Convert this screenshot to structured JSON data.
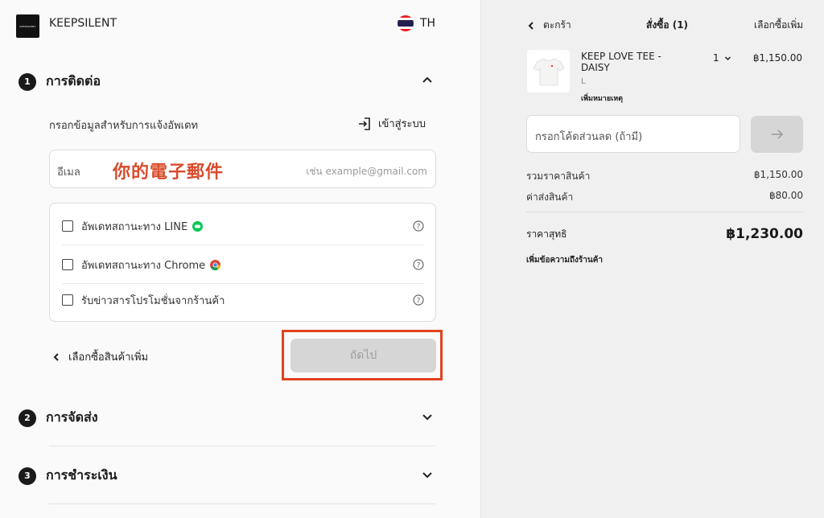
{
  "header": {
    "logo_text": "KEEPSILENT",
    "brand": "KEEPSILENT",
    "language": "TH"
  },
  "steps": [
    {
      "number": "1",
      "title": "การติดต่อ",
      "expanded": true
    },
    {
      "number": "2",
      "title": "การจัดส่ง",
      "expanded": false
    },
    {
      "number": "3",
      "title": "การชำระเงิน",
      "expanded": false
    }
  ],
  "contact": {
    "instruction": "กรอกข้อมูลสำหรับการแจ้งอัพเดท",
    "login_label": "เข้าสู่ระบบ",
    "email_label": "อีเมล",
    "email_value": "你的電子郵件",
    "email_placeholder": "เช่น example@gmail.com",
    "options": [
      {
        "label": "อัพเดทสถานะทาง LINE",
        "icon": "line-icon",
        "checked": false
      },
      {
        "label": "อัพเดทสถานะทาง Chrome",
        "icon": "chrome-icon",
        "checked": false
      },
      {
        "label": "รับข่าวสารโปรโมชั่นจากร้านค้า",
        "icon": "",
        "checked": false
      }
    ],
    "back_label": "เลือกซื้อสินค้าเพิ่ม",
    "next_label": "ถัดไป"
  },
  "cart": {
    "back_label": "ตะกร้า",
    "order_label": "สั่งซื้อ (1)",
    "more_label": "เลือกซื้อเพิ่ม",
    "item": {
      "name": "KEEP LOVE TEE - DAISY",
      "variant": "L",
      "note_link": "เพิ่มหมายเหตุ",
      "quantity": "1",
      "price": "฿1,150.00"
    },
    "coupon_placeholder": "กรอกโค้ดส่วนลด (ถ้ามี)",
    "subtotal_label": "รวมราคาสินค้า",
    "subtotal_value": "฿1,150.00",
    "shipping_label": "ค่าส่งสินค้า",
    "shipping_value": "฿80.00",
    "total_label": "ราคาสุทธิ",
    "total_value": "฿1,230.00",
    "add_message": "เพิ่มข้อความถึงร้านค้า"
  },
  "colors": {
    "accent_highlight": "#e0431e",
    "email_text": "#d94b2b",
    "line_green": "#06c755"
  }
}
